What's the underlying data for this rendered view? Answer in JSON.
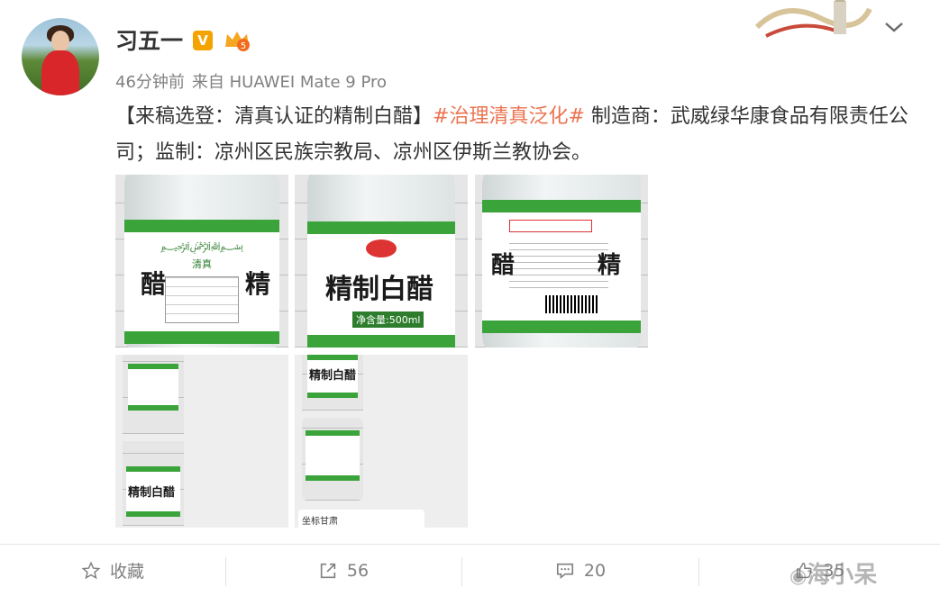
{
  "post": {
    "username": "习五一",
    "verified_badge": "V",
    "level_badge": "5",
    "time": "46分钟前",
    "source": "来自 HUAWEI Mate 9 Pro",
    "text_part1": "【来稿选登：清真认证的精制白醋】",
    "hashtag": "#治理清真泛化#",
    "text_part2": " 制造商：武威绿华康食品有限责任公司；监制：凉州区民族宗教局、凉州区伊斯兰教协会。"
  },
  "images": {
    "label_big_text": "精制白醋",
    "side_char_left": "醋",
    "side_char_right": "精",
    "label_small_text": "清真",
    "net_content": "净含量:500ml",
    "chat_text": "坐标甘肃"
  },
  "actions": {
    "favorite_icon": "star-icon",
    "favorite_label": "收藏",
    "repost_icon": "share-icon",
    "repost_count": "56",
    "comment_icon": "comment-icon",
    "comment_count": "20",
    "like_count": "35"
  },
  "watermark": "海小呆",
  "colors": {
    "hashtag": "#eb7350",
    "label_green": "#3aa33a",
    "verified": "#f4a300",
    "meta_gray": "#808080"
  }
}
